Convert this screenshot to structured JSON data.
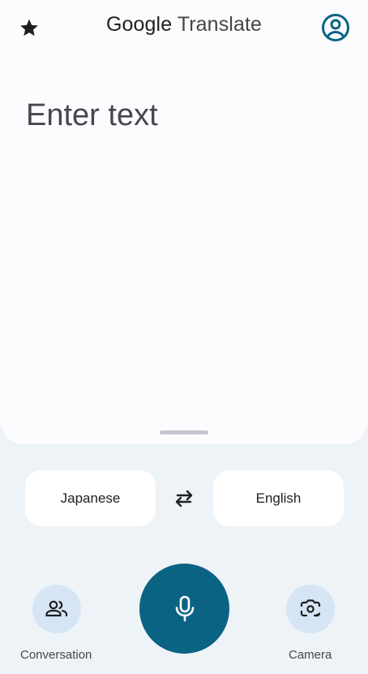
{
  "header": {
    "brand": "Google",
    "product": "Translate",
    "star_icon": "star-icon",
    "account_icon": "account-circle-icon"
  },
  "input": {
    "placeholder": "Enter text",
    "value": ""
  },
  "languages": {
    "source": "Japanese",
    "target": "English",
    "swap_icon": "swap-arrows-icon"
  },
  "actions": {
    "conversation_label": "Conversation",
    "camera_label": "Camera",
    "mic_icon": "microphone-icon",
    "conversation_icon": "people-icon",
    "camera_icon": "lens-camera-icon"
  },
  "colors": {
    "accent": "#0b6384",
    "background": "#eef3f8",
    "card": "#fcfcff",
    "chip": "#d6e5f3"
  }
}
